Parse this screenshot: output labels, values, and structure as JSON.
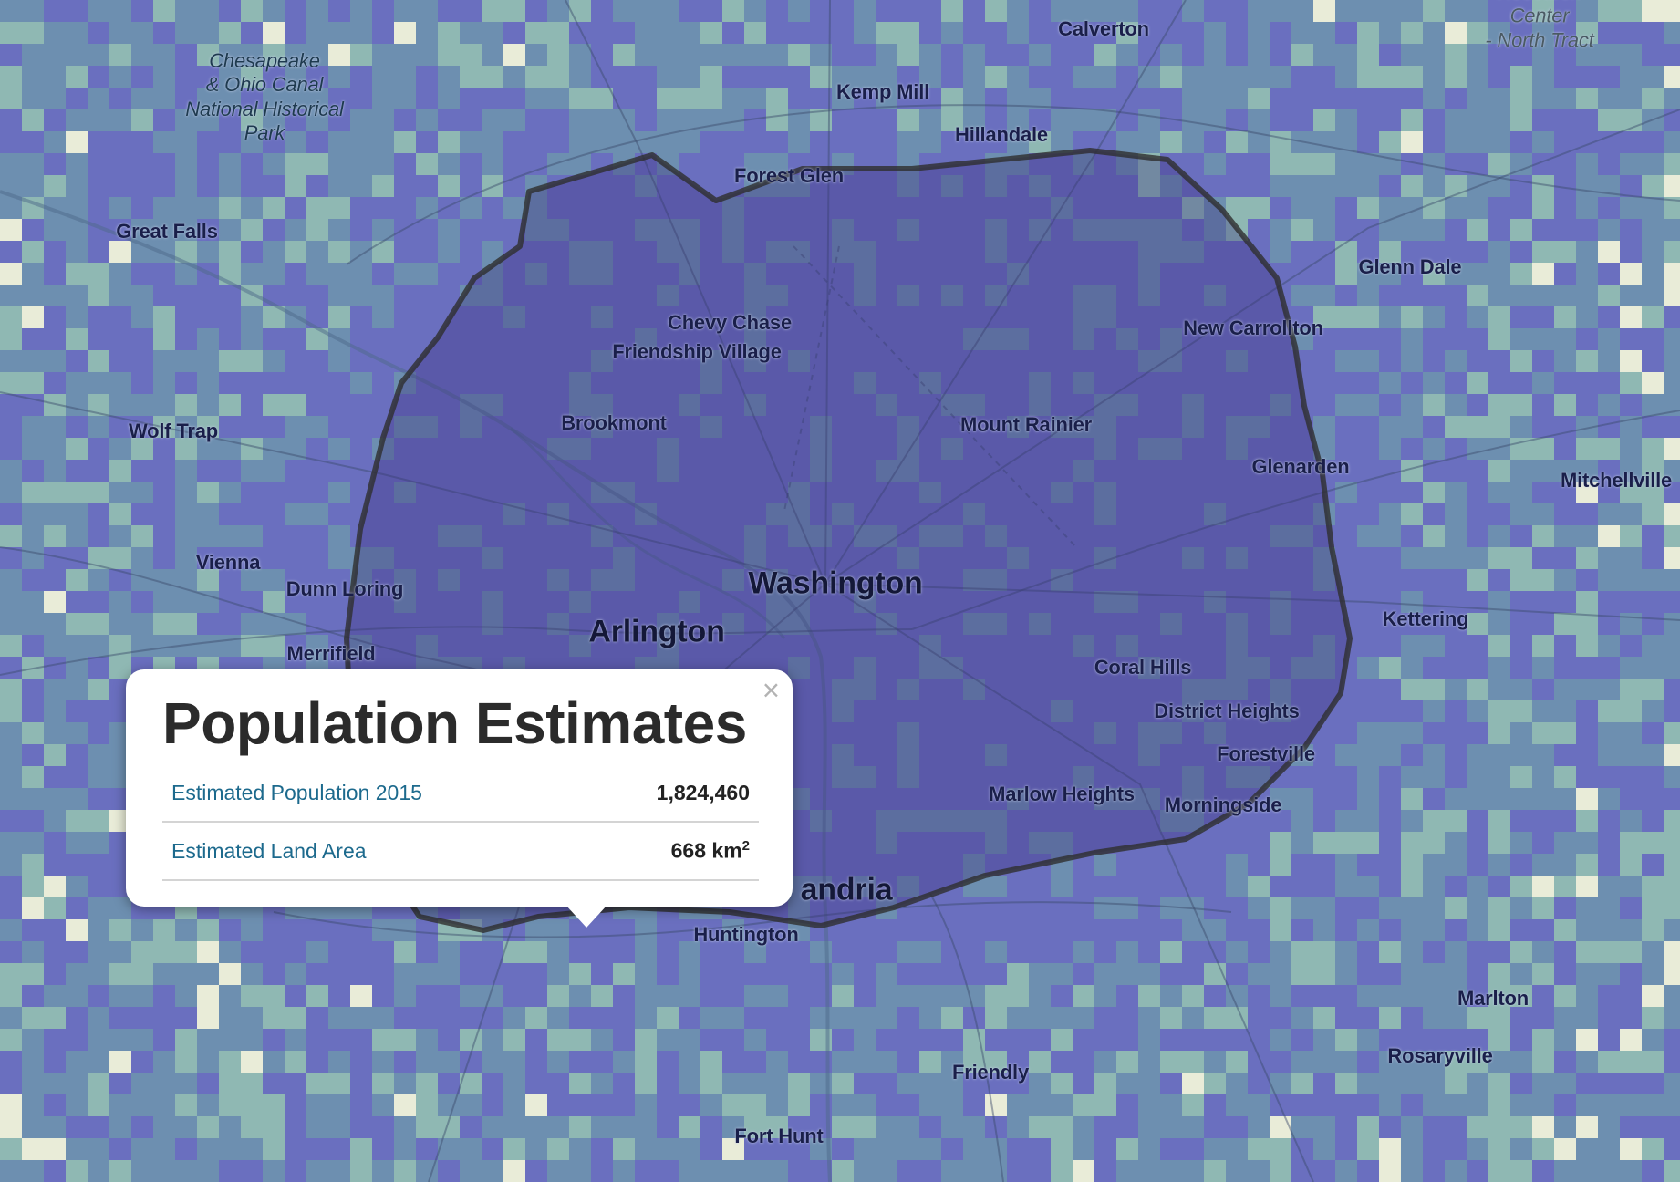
{
  "popup": {
    "title": "Population Estimates",
    "close_symbol": "×",
    "rows": [
      {
        "label": "Estimated Population 2015",
        "value": "1,824,460",
        "unit": "",
        "superscript": ""
      },
      {
        "label": "Estimated Land Area",
        "value": "668",
        "unit": "km",
        "superscript": "2"
      }
    ]
  },
  "map": {
    "colors": {
      "density_low": "#e9ecd8",
      "density_mid_low": "#8fb8b3",
      "density_mid": "#6d8fb0",
      "density_high": "#6a6fbf",
      "roads": "#3a4a6a",
      "selection_fill": "rgba(60,50,130,0.35)",
      "selection_stroke": "#2e2e2e"
    },
    "labels": {
      "research_center": "Research Center\n- North Tract",
      "calverton": "Calverton",
      "kemp_mill": "Kemp Mill",
      "hillandale": "Hillandale",
      "forest_glen": "Forest Glen",
      "chesapeake_park": "Chesapeake\n& Ohio Canal\nNational Historical\nPark",
      "great_falls": "Great Falls",
      "glenn_dale": "Glenn Dale",
      "new_carrollton": "New Carrollton",
      "chevy_chase": "Chevy Chase",
      "friendship_village": "Friendship Village",
      "wolf_trap": "Wolf Trap",
      "brookmont": "Brookmont",
      "mount_rainier": "Mount Rainier",
      "glenarden": "Glenarden",
      "mitchellville": "Mitchellville",
      "vienna": "Vienna",
      "dunn_loring": "Dunn Loring",
      "washington": "Washington",
      "arlington": "Arlington",
      "kettering": "Kettering",
      "merrifield": "Merrifield",
      "coral_hills": "Coral Hills",
      "district_heights": "District Heights",
      "forestville": "Forestville",
      "marlow_heights": "Marlow Heights",
      "morningside": "Morningside",
      "alexandria": "andria",
      "huntington": "Huntington",
      "marlton": "Marlton",
      "rosaryville": "Rosaryville",
      "friendly": "Friendly",
      "fort_hunt": "Fort Hunt"
    }
  }
}
